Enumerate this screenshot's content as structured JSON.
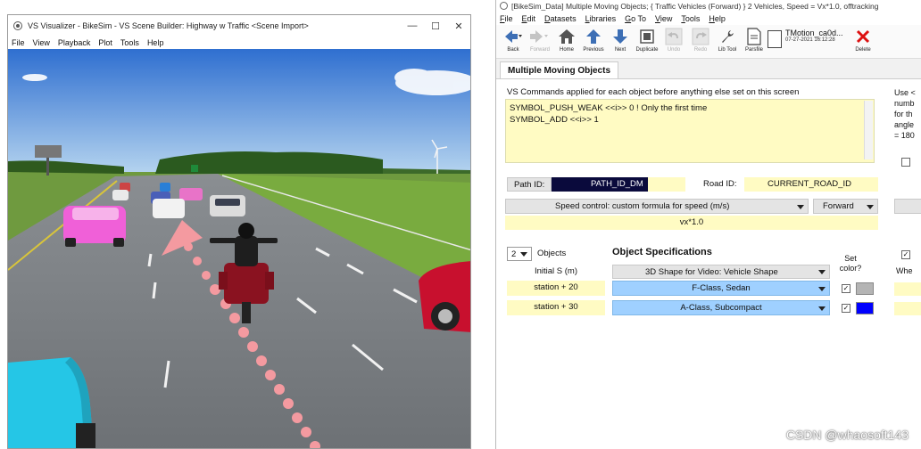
{
  "visualizer": {
    "title": "VS Visualizer - BikeSim - VS Scene Builder: Highway w Traffic <Scene Import>",
    "menu": [
      "File",
      "View",
      "Playback",
      "Plot",
      "Tools",
      "Help"
    ]
  },
  "bikesim": {
    "title": "[BikeSim_Data] Multiple Moving Objects; { Traffic Vehicles (Forward) } 2 Vehicles, Speed = Vx*1.0, offtracking",
    "menu": [
      "File",
      "Edit",
      "Datasets",
      "Libraries",
      "Go To",
      "View",
      "Tools",
      "Help"
    ],
    "toolbar": [
      {
        "label": "Back",
        "icon": "back-arrow-icon",
        "enabled": true
      },
      {
        "label": "Forward",
        "icon": "forward-arrow-icon",
        "enabled": false
      },
      {
        "label": "Home",
        "icon": "home-icon",
        "enabled": true
      },
      {
        "label": "Previous",
        "icon": "up-arrow-icon",
        "enabled": true
      },
      {
        "label": "Next",
        "icon": "down-arrow-icon",
        "enabled": true
      },
      {
        "label": "Duplicate",
        "icon": "duplicate-icon",
        "enabled": true
      },
      {
        "label": "Undo",
        "icon": "undo-icon",
        "enabled": false
      },
      {
        "label": "Redo",
        "icon": "redo-icon",
        "enabled": false
      },
      {
        "label": "Lib Tool",
        "icon": "wrench-icon",
        "enabled": true
      },
      {
        "label": "Parsfile",
        "icon": "document-icon",
        "enabled": true
      }
    ],
    "dataset_info": {
      "name": "TMotion_ca0d...",
      "timestamp": "07-27-2021 16:12:28"
    },
    "delete_label": "Delete",
    "tab": "Multiple Moving Objects",
    "commands_label": "VS Commands applied for each object before anything else set on this screen",
    "commands_lines": [
      "SYMBOL_PUSH_WEAK <<i>> 0 ! Only the first time",
      "SYMBOL_ADD <<i>> 1"
    ],
    "path_id_label": "Path ID:",
    "path_id_value": "PATH_ID_DM",
    "road_id_label": "Road ID:",
    "road_id_value": "CURRENT_ROAD_ID",
    "speed_control": "Speed control: custom formula for speed (m/s)",
    "direction": "Forward",
    "speed_formula": "vx*1.0",
    "object_count": "2",
    "objects_label": "Objects",
    "spec_title": "Object Specifications",
    "initial_s_header": "Initial S (m)",
    "shape_header": "3D Shape for Video: Vehicle Shape",
    "set_color_header": "Set color?",
    "objects": [
      {
        "initial_s": "station + 20",
        "shape": "F-Class, Sedan",
        "color": "#b4b4b4"
      },
      {
        "initial_s": "station + 30",
        "shape": "A-Class, Subcompact",
        "color": "#0000ff"
      }
    ],
    "right_partial": [
      "Use <",
      "numb",
      "for th",
      "angle",
      "= 180"
    ],
    "right_partial_extra": [
      "Whe"
    ]
  },
  "watermark": "CSDN @whaosoft143"
}
